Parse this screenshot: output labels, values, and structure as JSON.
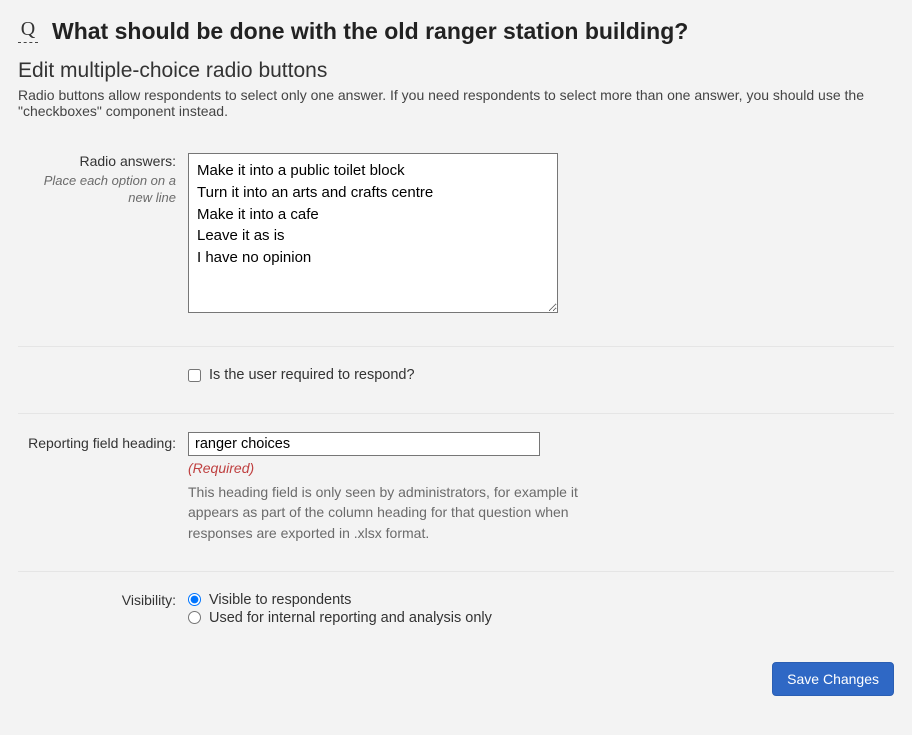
{
  "header": {
    "icon_glyph": "Q",
    "title": "What should be done with the old ranger station building?"
  },
  "section": {
    "heading": "Edit multiple-choice radio buttons",
    "description": "Radio buttons allow respondents to select only one answer. If you need respondents to select more than one answer, you should use the \"checkboxes\" component instead."
  },
  "radio_answers": {
    "label": "Radio answers:",
    "hint": "Place each option on a new line",
    "value": "Make it into a public toilet block\nTurn it into an arts and crafts centre\nMake it into a cafe\nLeave it as is\nI have no opinion"
  },
  "required": {
    "label": "Is the user required to respond?",
    "checked": false
  },
  "reporting": {
    "label": "Reporting field heading:",
    "value": "ranger choices",
    "required_note": "(Required)",
    "help": "This heading field is only seen by administrators, for example it appears as part of the column heading for that question when responses are exported in .xlsx format."
  },
  "visibility": {
    "label": "Visibility:",
    "options": [
      {
        "label": "Visible to respondents",
        "checked": true
      },
      {
        "label": "Used for internal reporting and analysis only",
        "checked": false
      }
    ]
  },
  "buttons": {
    "save": "Save Changes"
  }
}
